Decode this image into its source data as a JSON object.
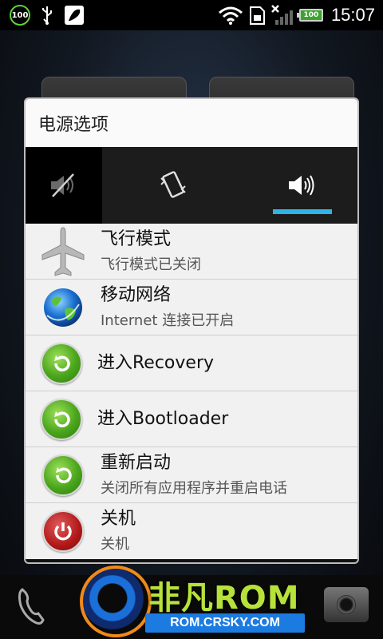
{
  "status_bar": {
    "battery_badge": "100",
    "battery_level": "100",
    "time": "15:07",
    "icons": [
      "battery-circle-icon",
      "usb-icon",
      "app-icon",
      "wifi-icon",
      "sd-card-icon",
      "signal-off-icon",
      "battery-icon"
    ]
  },
  "dialog": {
    "title": "电源选项",
    "sound_modes": [
      {
        "name": "silent",
        "icon": "mute-icon"
      },
      {
        "name": "vibrate",
        "icon": "vibrate-icon"
      },
      {
        "name": "sound",
        "icon": "speaker-icon",
        "selected": true
      }
    ],
    "items": [
      {
        "title": "飞行模式",
        "subtitle": "飞行模式已关闭",
        "icon": "airplane-icon"
      },
      {
        "title": "移动网络",
        "subtitle": "Internet 连接已开启",
        "icon": "globe-icon"
      },
      {
        "title": "进入Recovery",
        "subtitle": "",
        "icon": "refresh-icon"
      },
      {
        "title": "进入Bootloader",
        "subtitle": "",
        "icon": "refresh-icon"
      },
      {
        "title": "重新启动",
        "subtitle": "关闭所有应用程序并重启电话",
        "icon": "refresh-icon"
      },
      {
        "title": "关机",
        "subtitle": "关机",
        "icon": "power-icon"
      }
    ]
  },
  "watermark": {
    "title": "非凡ROM",
    "subtitle": "ROM.CRSKY.COM"
  },
  "colors": {
    "accent_blue": "#2eb5e6",
    "green": "#4aa51c",
    "red": "#b01818"
  }
}
